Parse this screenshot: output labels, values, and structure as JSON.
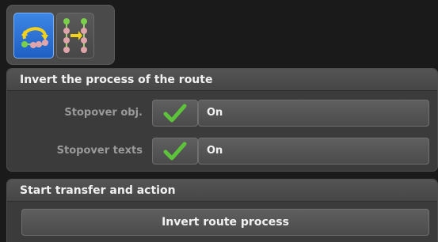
{
  "toolbar": {
    "tools": [
      {
        "icon": "reverse-route-icon",
        "active": true
      },
      {
        "icon": "route-nodes-icon",
        "active": false
      }
    ]
  },
  "invert_panel": {
    "title": "Invert the process of the route",
    "rows": [
      {
        "label": "Stopover obj.",
        "checked": true,
        "value": "On"
      },
      {
        "label": "Stopover texts",
        "checked": true,
        "value": "On"
      }
    ]
  },
  "transfer_panel": {
    "title": "Start transfer and action",
    "button_label": "Invert route process"
  },
  "colors": {
    "active_tool": "#2f74d8",
    "check": "#5cc33a",
    "node": "#d9a0a6"
  }
}
